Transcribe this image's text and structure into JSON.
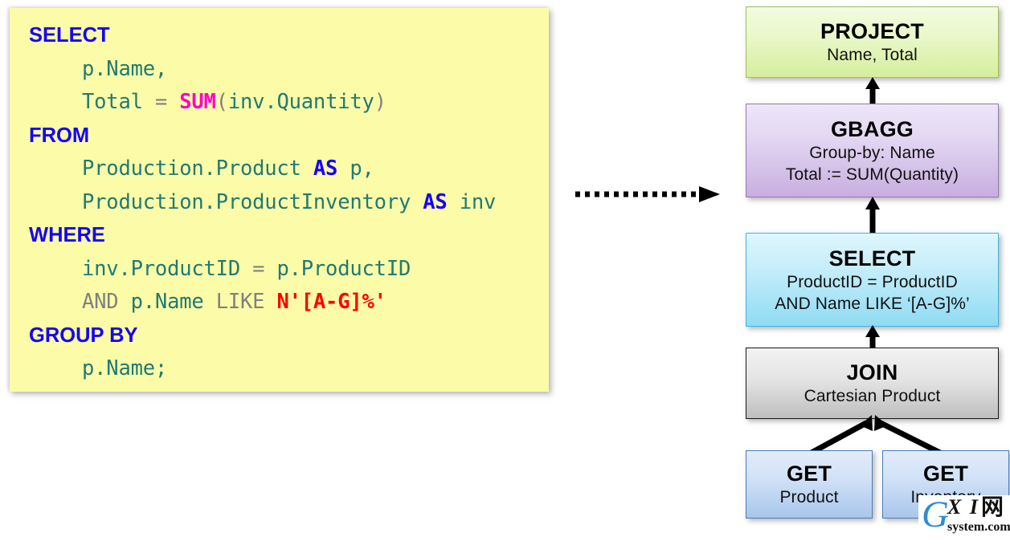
{
  "sql": {
    "lines": [
      [
        {
          "t": "SELECT",
          "c": "kw"
        }
      ],
      [
        {
          "t": "    ",
          "c": "ind"
        },
        {
          "t": "p.Name,",
          "c": "ident"
        }
      ],
      [
        {
          "t": "    ",
          "c": "ind"
        },
        {
          "t": "Total ",
          "c": "ident"
        },
        {
          "t": "= ",
          "c": "op"
        },
        {
          "t": "SUM",
          "c": "fn"
        },
        {
          "t": "(",
          "c": "op"
        },
        {
          "t": "inv.Quantity",
          "c": "ident"
        },
        {
          "t": ")",
          "c": "op"
        }
      ],
      [
        {
          "t": "FROM",
          "c": "kw"
        }
      ],
      [
        {
          "t": "    ",
          "c": "ind"
        },
        {
          "t": "Production.Product ",
          "c": "ident"
        },
        {
          "t": "AS",
          "c": "kw2"
        },
        {
          "t": " p,",
          "c": "ident"
        }
      ],
      [
        {
          "t": "    ",
          "c": "ind"
        },
        {
          "t": "Production.ProductInventory ",
          "c": "ident"
        },
        {
          "t": "AS",
          "c": "kw2"
        },
        {
          "t": " inv",
          "c": "ident"
        }
      ],
      [
        {
          "t": "WHERE",
          "c": "kw"
        }
      ],
      [
        {
          "t": "    ",
          "c": "ind"
        },
        {
          "t": "inv.ProductID ",
          "c": "ident"
        },
        {
          "t": "= ",
          "c": "op"
        },
        {
          "t": "p.ProductID",
          "c": "ident"
        }
      ],
      [
        {
          "t": "    ",
          "c": "ind"
        },
        {
          "t": "AND ",
          "c": "op"
        },
        {
          "t": "p.Name ",
          "c": "ident"
        },
        {
          "t": "LIKE ",
          "c": "op"
        },
        {
          "t": "N'[A-G]%'",
          "c": "str"
        }
      ],
      [
        {
          "t": "GROUP BY",
          "c": "kw"
        }
      ],
      [
        {
          "t": "    ",
          "c": "ind"
        },
        {
          "t": "p.Name;",
          "c": "ident"
        }
      ]
    ]
  },
  "tree": {
    "project": {
      "title": "PROJECT",
      "sub1": "Name, Total",
      "sub2": "",
      "color": "#D5EE9B"
    },
    "gbagg": {
      "title": "GBAGG",
      "sub1": "Group-by: Name",
      "sub2": "Total := SUM(Quantity)",
      "color": "#C9AEE0"
    },
    "select": {
      "title": "SELECT",
      "sub1": "ProductID = ProductID",
      "sub2": "AND Name LIKE ‘[A-G]%’",
      "color": "#8FDCF3"
    },
    "join": {
      "title": "JOIN",
      "sub1": "Cartesian Product",
      "sub2": "",
      "color": "#BEBEBE"
    },
    "get_product": {
      "title": "GET",
      "sub1": "Product",
      "sub2": "",
      "color": "#A8C6EC"
    },
    "get_inventory": {
      "title": "GET",
      "sub1": "Inventory",
      "sub2": "",
      "color": "#A8C6EC"
    }
  },
  "watermark": {
    "g": "G",
    "xi": "X I",
    "cjk": "网",
    "domain": "system.com"
  }
}
